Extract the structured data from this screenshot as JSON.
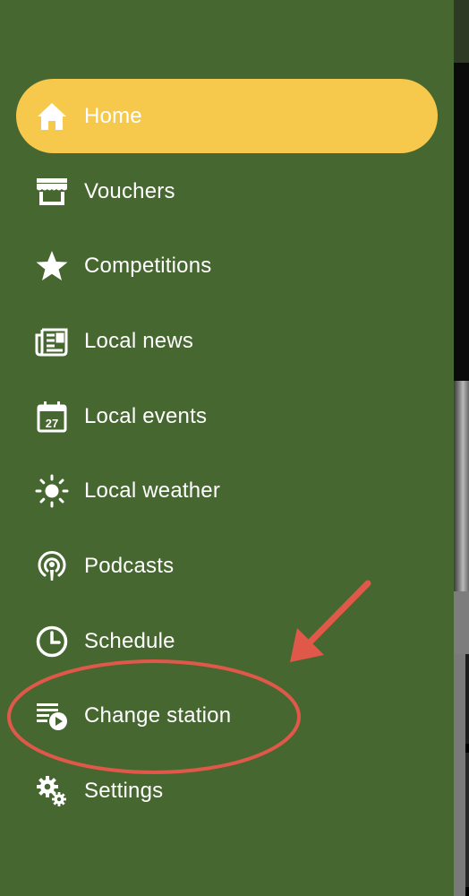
{
  "menu": {
    "items": [
      {
        "label": "Home",
        "icon": "home-icon",
        "active": true
      },
      {
        "label": "Vouchers",
        "icon": "storefront-icon"
      },
      {
        "label": "Competitions",
        "icon": "star-icon"
      },
      {
        "label": "Local news",
        "icon": "newspaper-icon"
      },
      {
        "label": "Local events",
        "icon": "calendar-icon"
      },
      {
        "label": "Local weather",
        "icon": "sun-icon"
      },
      {
        "label": "Podcasts",
        "icon": "podcast-icon"
      },
      {
        "label": "Schedule",
        "icon": "clock-icon"
      },
      {
        "label": "Change station",
        "icon": "playlist-play-icon"
      },
      {
        "label": "Settings",
        "icon": "gears-icon"
      }
    ],
    "calendar_day": "27"
  },
  "colors": {
    "drawer_bg": "#46672f",
    "active_bg": "#f6c94c",
    "text": "#ffffff",
    "annotation": "#e0584a"
  }
}
